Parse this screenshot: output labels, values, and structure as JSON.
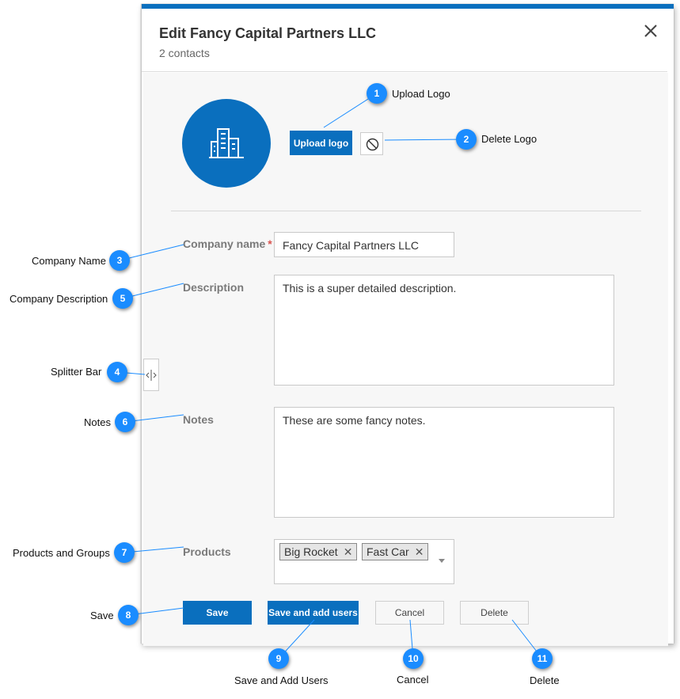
{
  "dialog": {
    "title": "Edit Fancy Capital Partners LLC",
    "subtitle": "2 contacts"
  },
  "logo": {
    "upload_label": "Upload logo",
    "icon": "building-icon",
    "delete_icon": "no-entry-icon"
  },
  "form": {
    "company_name_label": "Company name",
    "required_marker": "*",
    "company_name_value": "Fancy Capital Partners LLC",
    "description_label": "Description",
    "description_value": "This is a super detailed description.",
    "notes_label": "Notes",
    "notes_value": "These are some fancy notes.",
    "products_label": "Products",
    "products": [
      {
        "label": "Big Rocket",
        "remove": "✕"
      },
      {
        "label": "Fast Car",
        "remove": "✕"
      }
    ]
  },
  "actions": {
    "save": "Save",
    "save_add_users": "Save and add users",
    "cancel": "Cancel",
    "delete": "Delete"
  },
  "callouts": [
    {
      "num": "1",
      "text": "Upload Logo"
    },
    {
      "num": "2",
      "text": "Delete Logo"
    },
    {
      "num": "3",
      "text": "Company Name"
    },
    {
      "num": "4",
      "text": "Splitter Bar"
    },
    {
      "num": "5",
      "text": "Company Description"
    },
    {
      "num": "6",
      "text": "Notes"
    },
    {
      "num": "7",
      "text": "Products and Groups"
    },
    {
      "num": "8",
      "text": "Save"
    },
    {
      "num": "9",
      "text": "Save and Add Users"
    },
    {
      "num": "10",
      "text": "Cancel"
    },
    {
      "num": "11",
      "text": "Delete"
    }
  ],
  "colors": {
    "accent": "#0a6fbe",
    "callout_badge": "#1a8cff",
    "required": "#d9534f"
  }
}
